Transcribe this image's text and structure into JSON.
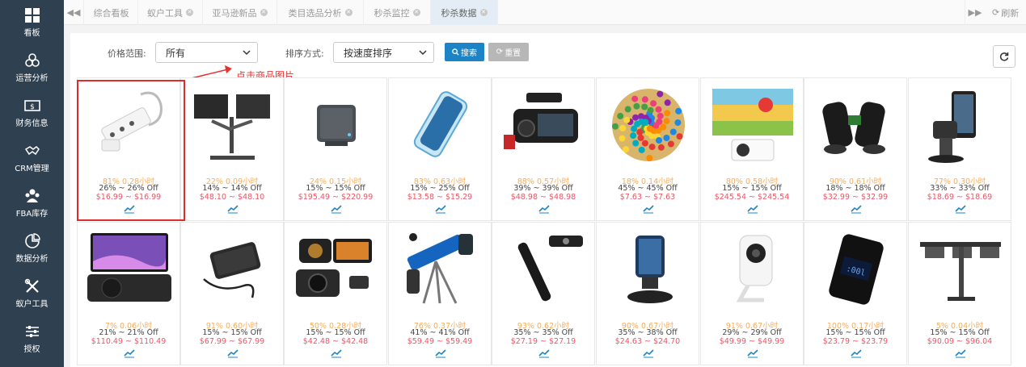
{
  "sidebar": {
    "items": [
      {
        "label": "看板",
        "icon": "dashboard-icon"
      },
      {
        "label": "运营分析",
        "icon": "operations-icon"
      },
      {
        "label": "财务信息",
        "icon": "finance-icon"
      },
      {
        "label": "CRM管理",
        "icon": "crm-icon"
      },
      {
        "label": "FBA库存",
        "icon": "inventory-icon"
      },
      {
        "label": "数据分析",
        "icon": "analytics-icon"
      },
      {
        "label": "蚁户工具",
        "icon": "tools-icon"
      },
      {
        "label": "授权",
        "icon": "sliders-icon"
      }
    ]
  },
  "tabs": {
    "items": [
      {
        "label": "综合看板",
        "closable": false
      },
      {
        "label": "蚁户工具",
        "closable": true
      },
      {
        "label": "亚马逊新品",
        "closable": true
      },
      {
        "label": "类目选品分析",
        "closable": true
      },
      {
        "label": "秒杀监控",
        "closable": true
      },
      {
        "label": "秒杀数据",
        "closable": true,
        "active": true
      }
    ],
    "refresh_label": "刷新"
  },
  "filters": {
    "price_label": "价格范围:",
    "price_value": "所有",
    "sort_label": "排序方式:",
    "sort_value": "按速度排序",
    "search_label": "搜索",
    "reset_label": "重置"
  },
  "annotation": {
    "text": "点击商品图片",
    "color": "#e53333"
  },
  "colors": {
    "sidebar": "#2f4050",
    "primary": "#1c84c6",
    "orange": "#f8ac59",
    "red": "#ed5565",
    "active_tab": "#e4ecf5"
  },
  "products": [
    {
      "name": "power strip",
      "l1": "81% 0.28小时",
      "l2": "26% ~ 26% Off",
      "l3": "$16.99 ~ $16.99"
    },
    {
      "name": "dual monitor arm",
      "l1": "22% 0.09小时",
      "l2": "14% ~ 14% Off",
      "l3": "$48.10 ~ $48.10"
    },
    {
      "name": "mini pc",
      "l1": "24% 0.15小时",
      "l2": "15% ~ 15% Off",
      "l3": "$195.49 ~ $220.99"
    },
    {
      "name": "phone case",
      "l1": "83% 0.63小时",
      "l2": "15% ~ 25% Off",
      "l3": "$13.58 ~ $15.29"
    },
    {
      "name": "dash cam",
      "l1": "88% 0.57小时",
      "l2": "39% ~ 39% Off",
      "l3": "$48.98 ~ $48.98"
    },
    {
      "name": "sticker pack",
      "l1": "18% 0.14小时",
      "l2": "45% ~ 45% Off",
      "l3": "$7.63 ~ $7.63"
    },
    {
      "name": "projector",
      "l1": "80% 0.58小时",
      "l2": "15% ~ 15% Off",
      "l3": "$245.54 ~ $245.54"
    },
    {
      "name": "binoculars",
      "l1": "90% 0.61小时",
      "l2": "18% ~ 18% Off",
      "l3": "$32.99 ~ $32.99"
    },
    {
      "name": "car phone mount",
      "l1": "77% 0.30小时",
      "l2": "33% ~ 33% Off",
      "l3": "$18.69 ~ $18.69"
    },
    {
      "name": "portable dvd player",
      "l1": "7% 0.06小时",
      "l2": "21% ~ 21% Off",
      "l3": "$110.49 ~ $110.49"
    },
    {
      "name": "external ssd",
      "l1": "91% 0.60小时",
      "l2": "15% ~ 15% Off",
      "l3": "$67.99 ~ $67.99"
    },
    {
      "name": "car dash cam",
      "l1": "50% 0.28小时",
      "l2": "15% ~ 15% Off",
      "l3": "$42.48 ~ $42.48"
    },
    {
      "name": "telescope",
      "l1": "76% 0.37小时",
      "l2": "41% ~ 41% Off",
      "l3": "$59.49 ~ $59.49"
    },
    {
      "name": "camera pen",
      "l1": "93% 0.62小时",
      "l2": "35% ~ 35% Off",
      "l3": "$27.19 ~ $27.19"
    },
    {
      "name": "wireless car charger",
      "l1": "90% 0.67小时",
      "l2": "35% ~ 38% Off",
      "l3": "$24.63 ~ $24.70"
    },
    {
      "name": "security camera",
      "l1": "91% 0.67小时",
      "l2": "29% ~ 29% Off",
      "l3": "$49.99 ~ $49.99"
    },
    {
      "name": "power bank",
      "l1": "100% 0.17小时",
      "l2": "15% ~ 15% Off",
      "l3": "$23.79 ~ $23.79"
    },
    {
      "name": "triple monitor mount",
      "l1": "5% 0.04小时",
      "l2": "15% ~ 15% Off",
      "l3": "$90.09 ~ $96.04"
    }
  ]
}
